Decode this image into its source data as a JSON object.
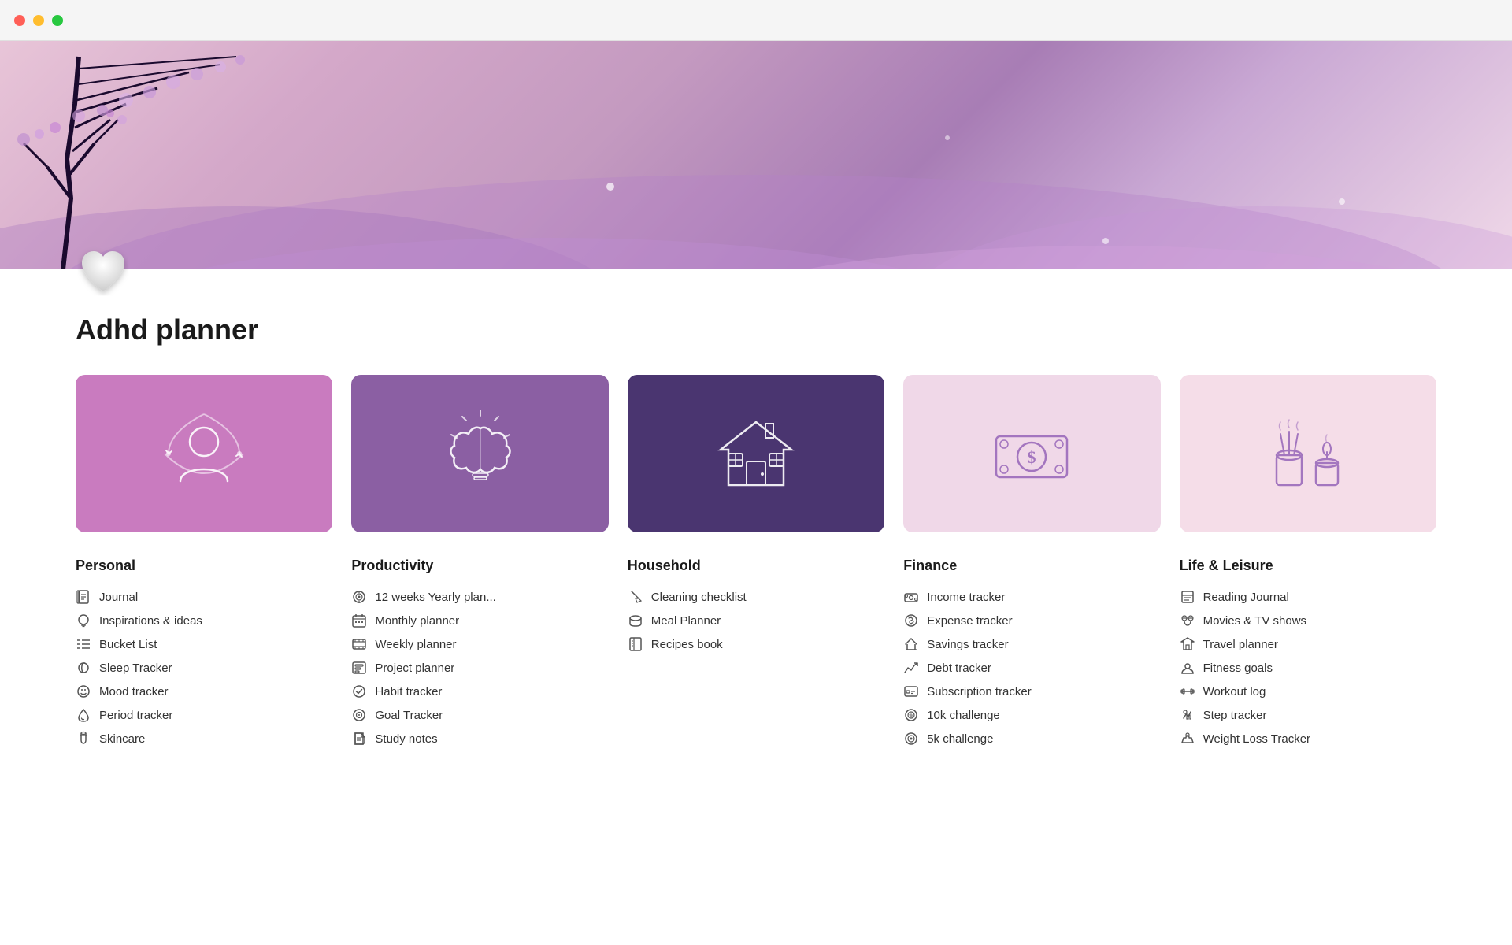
{
  "titlebar": {
    "controls": [
      "close",
      "minimize",
      "maximize"
    ]
  },
  "page": {
    "title": "Adhd planner",
    "heart_emoji": "🤍"
  },
  "cards": [
    {
      "id": "personal",
      "label": "Personal",
      "color_class": "card-personal",
      "icon": "person-refresh"
    },
    {
      "id": "productivity",
      "label": "Productivity",
      "color_class": "card-productivity",
      "icon": "brain-lightbulb"
    },
    {
      "id": "household",
      "label": "Household",
      "color_class": "card-household",
      "icon": "house"
    },
    {
      "id": "finance",
      "label": "Finance",
      "color_class": "card-finance",
      "icon": "money"
    },
    {
      "id": "leisure",
      "label": "Life & Leisure",
      "color_class": "card-leisure",
      "icon": "candle"
    }
  ],
  "columns": [
    {
      "title": "Personal",
      "items": [
        {
          "label": "Journal",
          "icon": "journal"
        },
        {
          "label": "Inspirations & ideas",
          "icon": "lightbulb"
        },
        {
          "label": "Bucket List",
          "icon": "list"
        },
        {
          "label": "Sleep Tracker",
          "icon": "sleep"
        },
        {
          "label": "Mood tracker",
          "icon": "mood"
        },
        {
          "label": "Period tracker",
          "icon": "drop"
        },
        {
          "label": "Skincare",
          "icon": "skincare"
        }
      ]
    },
    {
      "title": "Productivity",
      "items": [
        {
          "label": "12 weeks Yearly plan...",
          "icon": "target"
        },
        {
          "label": "Monthly planner",
          "icon": "calendar"
        },
        {
          "label": "Weekly planner",
          "icon": "film"
        },
        {
          "label": "Project planner",
          "icon": "project"
        },
        {
          "label": "Habit tracker",
          "icon": "check-circle"
        },
        {
          "label": "Goal Tracker",
          "icon": "goal"
        },
        {
          "label": "Study notes",
          "icon": "note"
        }
      ]
    },
    {
      "title": "Household",
      "items": [
        {
          "label": "Cleaning checklist",
          "icon": "broom"
        },
        {
          "label": "Meal Planner",
          "icon": "meal"
        },
        {
          "label": "Recipes book",
          "icon": "book"
        }
      ]
    },
    {
      "title": "Finance",
      "items": [
        {
          "label": "Income tracker",
          "icon": "income"
        },
        {
          "label": "Expense tracker",
          "icon": "expense"
        },
        {
          "label": "Savings tracker",
          "icon": "savings"
        },
        {
          "label": "Debt tracker",
          "icon": "debt"
        },
        {
          "label": "Subscription tracker",
          "icon": "subscription"
        },
        {
          "label": "10k challenge",
          "icon": "challenge"
        },
        {
          "label": "5k challenge",
          "icon": "challenge2"
        }
      ]
    },
    {
      "title": "Life & Leisure",
      "items": [
        {
          "label": "Reading Journal",
          "icon": "reading"
        },
        {
          "label": "Movies & TV shows",
          "icon": "movies"
        },
        {
          "label": "Travel planner",
          "icon": "travel"
        },
        {
          "label": "Fitness goals",
          "icon": "fitness"
        },
        {
          "label": "Workout log",
          "icon": "workout"
        },
        {
          "label": "Step tracker",
          "icon": "steps"
        },
        {
          "label": "Weight Loss Tracker",
          "icon": "weight"
        }
      ]
    }
  ]
}
